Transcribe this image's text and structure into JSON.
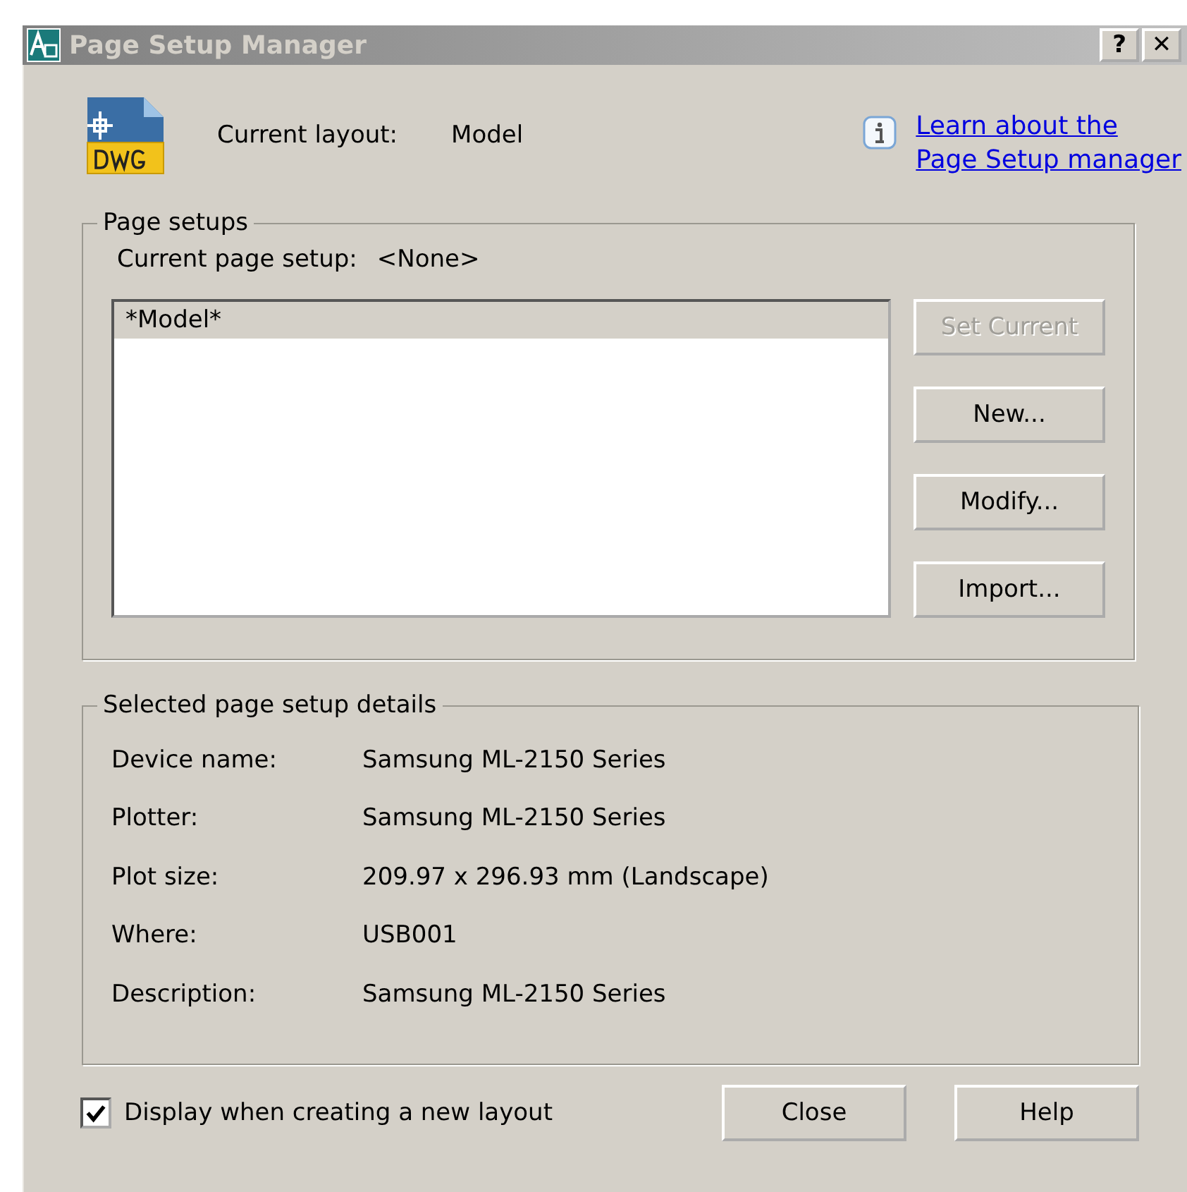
{
  "window": {
    "title": "Page Setup Manager",
    "title_buttons": [
      "?",
      "✕"
    ]
  },
  "current_layout": {
    "label": "Current layout:",
    "value": "Model"
  },
  "help_link": {
    "lines": [
      "Learn about the",
      "Page Setup manager"
    ]
  },
  "page_setups": {
    "title": "Page setups",
    "current_label": "Current page setup:",
    "current_value": "<None>",
    "items": [
      {
        "label": "*Model*",
        "selected": true
      }
    ],
    "buttons": [
      {
        "label": "Set Current",
        "disabled": true
      },
      {
        "label": "New...",
        "disabled": false
      },
      {
        "label": "Modify...",
        "disabled": false
      },
      {
        "label": "Import...",
        "disabled": false
      }
    ]
  },
  "details": {
    "title": "Selected page setup details",
    "rows": [
      {
        "label": "Device name:",
        "value": "Samsung ML-2150 Series"
      },
      {
        "label": "Plotter:",
        "value": "Samsung ML-2150 Series"
      },
      {
        "label": "Plot size:",
        "value": "209.97 x 296.93 mm (Landscape)"
      },
      {
        "label": "Where:",
        "value": "USB001"
      },
      {
        "label": "Description:",
        "value": "Samsung ML-2150 Series"
      }
    ]
  },
  "display_option": {
    "label": "Display when creating a new layout",
    "checked": true
  },
  "buttons": [
    "Close",
    "Help"
  ]
}
